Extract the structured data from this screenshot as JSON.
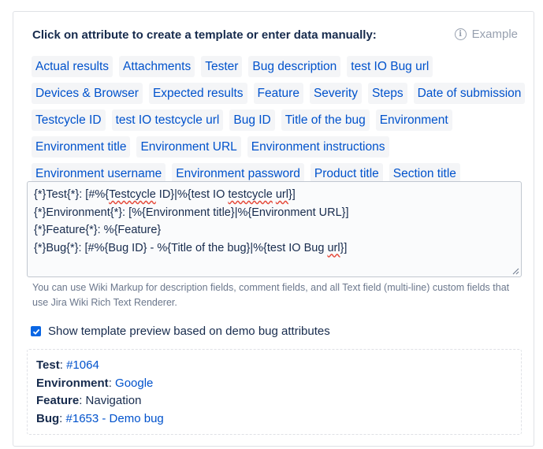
{
  "header": {
    "title": "Click on attribute to create a template or enter data manually:",
    "example_label": "Example",
    "example_icon": "info-icon"
  },
  "attributes": [
    "Actual results",
    "Attachments",
    "Tester",
    "Bug description",
    "test IO Bug url",
    "Devices & Browser",
    "Expected results",
    "Feature",
    "Severity",
    "Steps",
    "Date of submission",
    "Testcycle ID",
    "test IO testcycle url",
    "Bug ID",
    "Title of the bug",
    "Environment",
    "Environment title",
    "Environment URL",
    "Environment instructions",
    "Environment username",
    "Environment password",
    "Product title",
    "Section title"
  ],
  "template": {
    "lines": [
      "{*}Test{*}: [#%{Testcycle ID}|%{test IO testcycle url}]",
      "{*}Environment{*}: [%{Environment title}|%{Environment URL}]",
      "{*}Feature{*}: %{Feature}",
      "{*}Bug{*}: [#%{Bug ID} - %{Title of the bug}|%{test IO Bug url}]"
    ]
  },
  "hint": "You can use Wiki Markup for description fields, comment fields, and all Text field (multi-line) custom fields that use Jira Wiki Rich Text Renderer.",
  "preview_toggle": {
    "label": "Show template preview based on demo bug attributes",
    "checked": true
  },
  "preview": [
    {
      "label": "Test",
      "value": "#1064",
      "link": true
    },
    {
      "label": "Environment",
      "value": "Google",
      "link": true
    },
    {
      "label": "Feature",
      "value": "Navigation",
      "link": false
    },
    {
      "label": "Bug",
      "value": "#1653 - Demo bug",
      "link": true
    }
  ],
  "colors": {
    "chip_text": "#0052cc",
    "chip_bg": "#f4f5f7",
    "checkbox": "#0a66e4"
  }
}
